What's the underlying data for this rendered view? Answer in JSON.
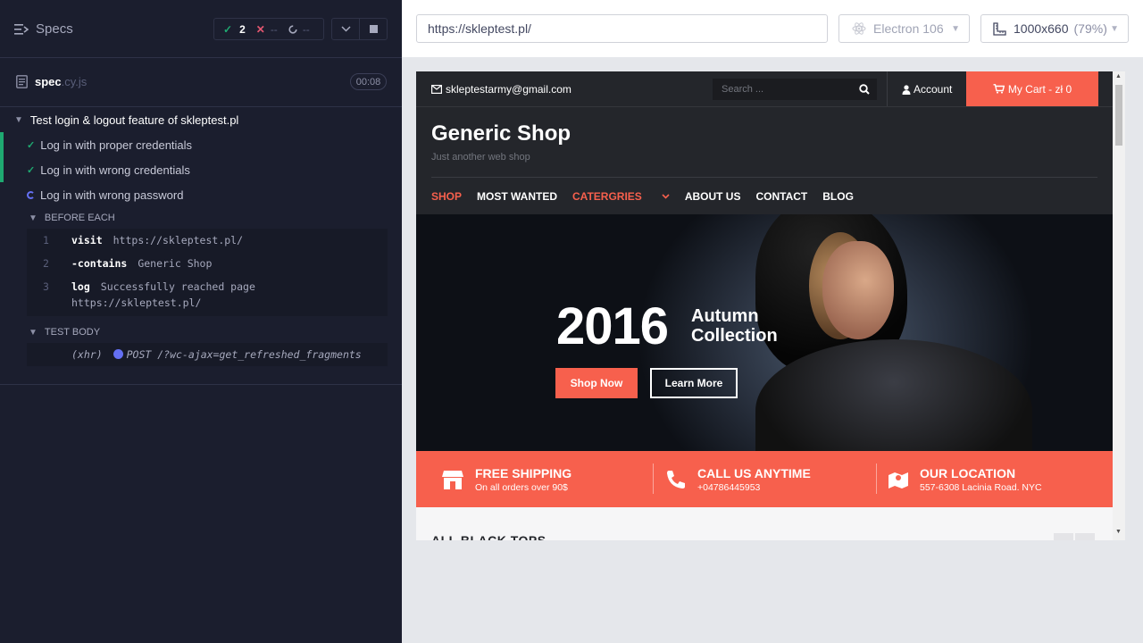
{
  "runner": {
    "header": {
      "title": "Specs",
      "passed_count": "2",
      "failed_count": "--",
      "pending_count": "--"
    },
    "spec_file": {
      "name": "spec",
      "ext": ".cy.js",
      "duration": "00:08"
    },
    "suite": {
      "title": "Test login & logout feature of skleptest.pl",
      "tests": [
        {
          "label": "Log in with proper credentials",
          "state": "passed"
        },
        {
          "label": "Log in with wrong credentials",
          "state": "passed"
        },
        {
          "label": "Log in with wrong password",
          "state": "running"
        }
      ]
    },
    "before_each": {
      "label": "BEFORE EACH",
      "commands": [
        {
          "num": "1",
          "name": "visit",
          "msg": "https://skleptest.pl/"
        },
        {
          "num": "2",
          "name": "-contains",
          "msg": "Generic Shop"
        },
        {
          "num": "3",
          "name": "log",
          "msg": "Successfully reached page",
          "msg2": "https://skleptest.pl/"
        }
      ]
    },
    "test_body": {
      "label": "TEST BODY",
      "xhr_name": "(xhr)",
      "xhr_msg": "POST /?wc-ajax=get_refreshed_fragments"
    }
  },
  "preview": {
    "url": "https://skleptest.pl/",
    "browser": "Electron 106",
    "viewport": "1000x660",
    "zoom": "(79%)"
  },
  "site": {
    "email": "skleptestarmy@gmail.com",
    "search_placeholder": "Search ...",
    "account": "Account",
    "cart": "My Cart - zł 0",
    "logo": "Generic Shop",
    "tagline": "Just another web shop",
    "menu": [
      "SHOP",
      "MOST WANTED",
      "CATERGRIES",
      "ABOUT US",
      "CONTACT",
      "BLOG"
    ],
    "hero": {
      "year": "2016",
      "line1": "Autumn",
      "line2": "Collection",
      "shop_btn": "Shop Now",
      "learn_btn": "Learn More"
    },
    "info": [
      {
        "title": "FREE SHIPPING",
        "sub": "On all orders over 90$",
        "icon": "store-icon"
      },
      {
        "title": "CALL US ANYTIME",
        "sub": "+04786445953",
        "icon": "phone-icon"
      },
      {
        "title": "OUR LOCATION",
        "sub": "557-6308 Lacinia Road. NYC",
        "icon": "map-icon"
      }
    ],
    "section_title": "ALL BLACK TOPS"
  },
  "colors": {
    "runner_bg": "#1b1e2e",
    "pass": "#1fa971",
    "fail": "#e45770",
    "accent": "#6470f3",
    "site_accent": "#f7604d",
    "site_dark": "#24262b"
  }
}
